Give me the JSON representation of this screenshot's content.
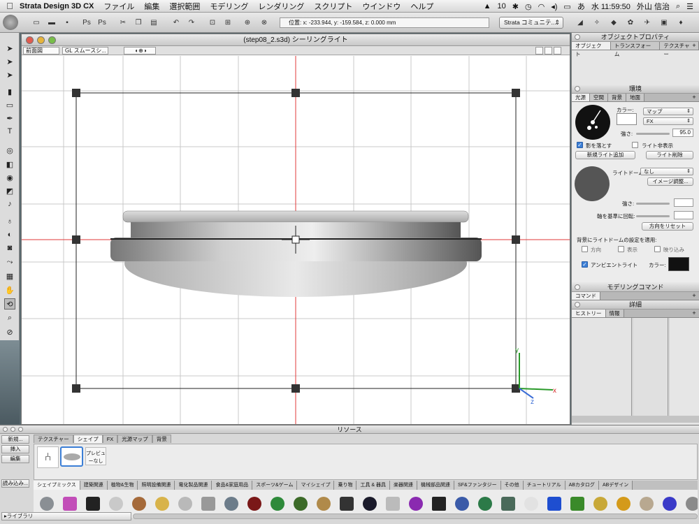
{
  "menubar": {
    "app_name": "Strata Design 3D CX",
    "items": [
      "ファイル",
      "編集",
      "選択範囲",
      "モデリング",
      "レンダリング",
      "スクリプト",
      "ウインドウ",
      "ヘルプ"
    ],
    "badge": "10",
    "clock": "水 11:59:50",
    "user": "外山 信治"
  },
  "toolbar": {
    "coords": "位置: x: -233.944, y: -159.584, z: 0.000 mm",
    "community": "Strata コミュニテ..."
  },
  "document": {
    "title": "(step08_2.s3d) シーリングライト",
    "view": "前面図",
    "render_mode": "GL スムースシ..."
  },
  "object_props": {
    "title": "オブジェクトプロパティ",
    "tabs": [
      "オブジェクト",
      "トランスフォーム",
      "テクスチャー"
    ]
  },
  "environment": {
    "title": "環境",
    "tabs": [
      "光源",
      "空間",
      "背景",
      "地面"
    ],
    "color_label": "カラー:",
    "map_label": "マップ",
    "fx_label": "FX",
    "strength_label": "強さ:",
    "strength_value": "95.0",
    "cast_shadow": "影を落とす",
    "hide_light": "ライト非表示",
    "add_light": "新規ライト追加",
    "delete_light": "ライト削除",
    "dome_label": "ライトドーム:",
    "dome_value": "なし",
    "image_adjust": "イメージ調整...",
    "strength2_label": "強さ:",
    "rotate_label": "軸を基準に回転:",
    "reset_dir": "方向をリセット",
    "apply_label": "背景にライトドームの設定を適用:",
    "opt_dir": "方向",
    "opt_show": "表示",
    "opt_reflect": "映り込み",
    "ambient": "アンビエントライト",
    "ambient_color": "カラー:",
    "accent_color": "#3c7fd6"
  },
  "modeling": {
    "title": "モデリングコマンド",
    "tab": "コマンド"
  },
  "details": {
    "title": "詳細",
    "tabs": [
      "ヒストリー",
      "情報"
    ]
  },
  "resources": {
    "title": "リソース",
    "left_buttons": [
      "新規...",
      "挿入",
      "編集"
    ],
    "load_button": "読み込み...",
    "library_label": "▸ライブラリ",
    "tabs": [
      "テクスチャー",
      "シェイプ",
      "FX",
      "光源マップ",
      "背景"
    ],
    "preview_label": "プレビューなし",
    "categories": [
      "シェイプミックス",
      "建築関連",
      "植物&生物",
      "照明設備関連",
      "電化製品関連",
      "食品&家庭用品",
      "スポーツ&ゲーム",
      "マイシェイプ",
      "乗り物",
      "工具 & 器具",
      "楽器関連",
      "機械部品関連",
      "SF&ファンタジー",
      "その他",
      "チュートリアル",
      "ABカタログ",
      "ABデザイン"
    ]
  }
}
